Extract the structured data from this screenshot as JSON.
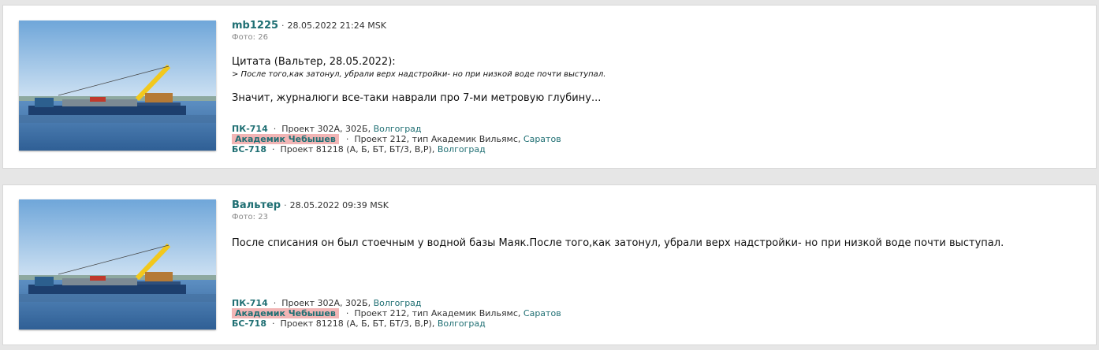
{
  "posts": [
    {
      "author": "mb1225",
      "datetime": "28.05.2022 21:24 MSK",
      "photos": "Фото: 26",
      "quote_title": "Цитата (Вальтер, 28.05.2022):",
      "quote_text": "> После того,как затонул, убрали верх надстройки- но при низкой воде почти выступал.",
      "message": "Значит, журналюги все-таки наврали про 7-ми метровую глубину...",
      "vessels": [
        {
          "name": "ПК-714",
          "project": "Проект 302А, 302Б,",
          "city": "Волгоград",
          "highlight": false
        },
        {
          "name": "Академик Чебышев",
          "project": "Проект 212, тип Академик Вильямс,",
          "city": "Саратов",
          "highlight": true
        },
        {
          "name": "БС-718",
          "project": "Проект 81218 (А, Б, БТ, БТ/3, В,Р),",
          "city": "Волгоград",
          "highlight": false
        }
      ]
    },
    {
      "author": "Вальтер",
      "datetime": "28.05.2022 09:39 MSK",
      "photos": "Фото: 23",
      "message": "После списания он был стоечным у водной базы Маяк.После того,как затонул, убрали верх надстройки- но при низкой воде почти выступал.",
      "vessels": [
        {
          "name": "ПК-714",
          "project": "Проект 302А, 302Б,",
          "city": "Волгоград",
          "highlight": false
        },
        {
          "name": "Академик Чебышев",
          "project": "Проект 212, тип Академик Вильямс,",
          "city": "Саратов",
          "highlight": true
        },
        {
          "name": "БС-718",
          "project": "Проект 81218 (А, Б, БТ, БТ/3, В,Р),",
          "city": "Волгоград",
          "highlight": false
        }
      ]
    }
  ],
  "separator": "·",
  "colors": {
    "link": "#1f6f73",
    "highlight": "#f2b5b5"
  }
}
